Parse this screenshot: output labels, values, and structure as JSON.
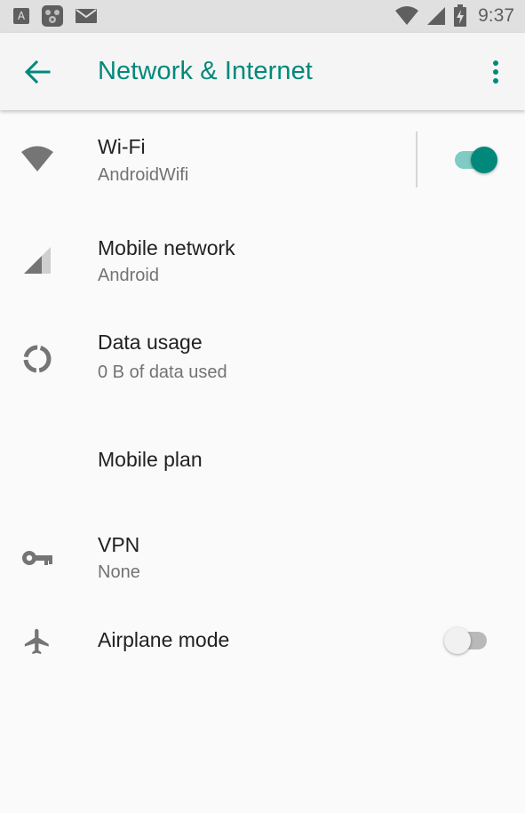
{
  "status_bar": {
    "time": "9:37",
    "left_icons": [
      "a-icon",
      "game-icon",
      "mail-icon"
    ],
    "right_icons": [
      "wifi-signal-icon",
      "cell-signal-icon",
      "battery-charging-icon"
    ]
  },
  "app_bar": {
    "title": "Network & Internet",
    "back_icon": "arrow-back-icon",
    "overflow_icon": "more-vert-icon"
  },
  "items": [
    {
      "id": "wifi",
      "icon": "wifi-icon",
      "title": "Wi-Fi",
      "summary": "AndroidWifi",
      "toggle": true
    },
    {
      "id": "mobile-network",
      "icon": "signal-icon",
      "title": "Mobile network",
      "summary": "Android"
    },
    {
      "id": "data-usage",
      "icon": "data-usage-icon",
      "title": "Data usage",
      "summary": "0 B of data used"
    },
    {
      "id": "mobile-plan",
      "icon": "",
      "title": "Mobile plan",
      "summary": ""
    },
    {
      "id": "vpn",
      "icon": "key-icon",
      "title": "VPN",
      "summary": "None"
    },
    {
      "id": "airplane-mode",
      "icon": "airplane-icon",
      "title": "Airplane mode",
      "summary": "",
      "toggle": false
    }
  ],
  "colors": {
    "accent": "#00897b",
    "accent_track": "#80cbc4",
    "title_text": "#212121",
    "summary_text": "#737373",
    "icon_gray": "#757575",
    "status_bar": "#e0e0e0",
    "app_bar": "#f5f5f5",
    "background": "#fafafa",
    "switch_off_thumb": "#f1f1f1",
    "switch_off_track": "#b9b9b9"
  }
}
